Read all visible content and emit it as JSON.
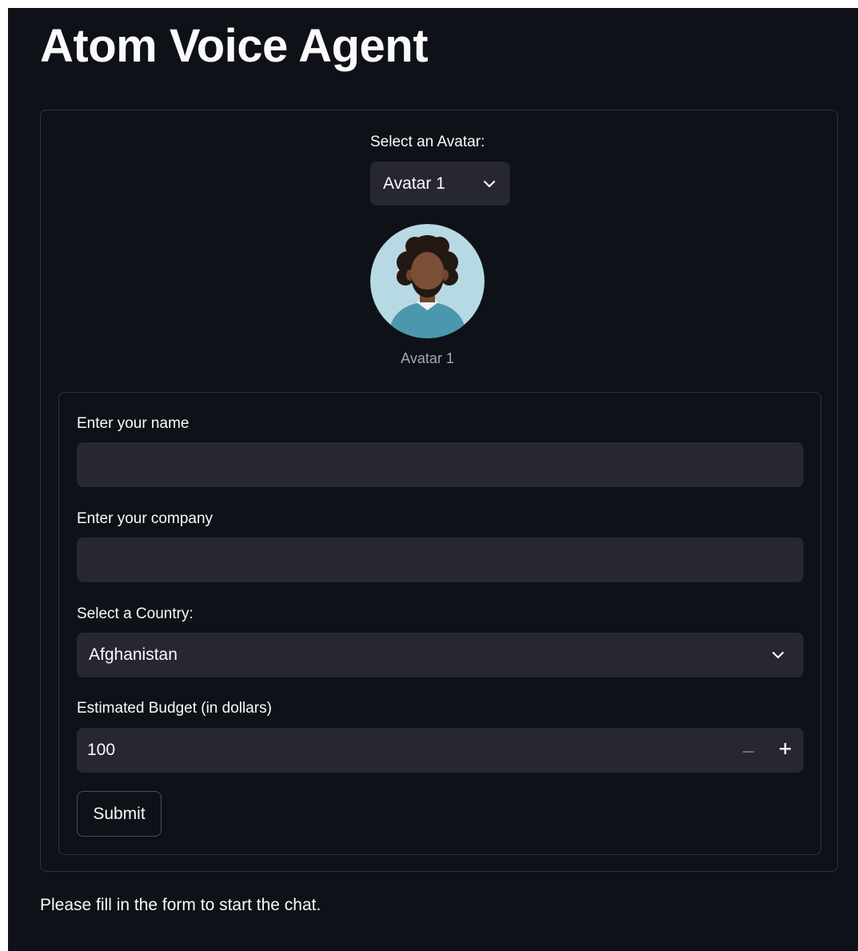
{
  "page": {
    "title": "Atom Voice Agent"
  },
  "avatar": {
    "select_label": "Select an Avatar:",
    "selected": "Avatar 1",
    "caption": "Avatar 1",
    "icon": "chevron-down-icon"
  },
  "form": {
    "name_label": "Enter your name",
    "name_value": "",
    "company_label": "Enter your company",
    "company_value": "",
    "country_label": "Select a Country:",
    "country_selected": "Afghanistan",
    "budget_label": "Estimated Budget (in dollars)",
    "budget_value": "100",
    "decrement_icon": "minus-icon",
    "increment_icon": "plus-icon",
    "submit_label": "Submit"
  },
  "status": {
    "message": "Please fill in the form to start the chat."
  },
  "colors": {
    "background": "#0e1117",
    "input_background": "#262730",
    "border": "#30333d",
    "text": "#fafafa",
    "muted_text": "#a3a8b4"
  }
}
